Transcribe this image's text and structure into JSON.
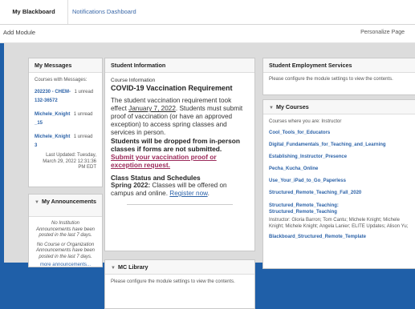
{
  "tabs": {
    "active": "My Blackboard",
    "inactive": "Notifications Dashboard"
  },
  "toolbar": {
    "add_module": "Add Module",
    "personalize": "Personalize Page"
  },
  "messages": {
    "title": "My Messages",
    "intro": "Courses with Messages:",
    "items": [
      {
        "name": "202230 - CHEM-",
        "count": "1 unread",
        "name2": "132-36572"
      },
      {
        "name": "Michele_Knight",
        "count": "1 unread",
        "name2": "_15"
      },
      {
        "name": "Michele_Knight",
        "count": "1 unread",
        "name2": "3"
      }
    ],
    "last_updated": "Last Updated: Tuesday, March 29, 2022 12:31:36 PM EDT"
  },
  "announcements": {
    "title": "My Announcements",
    "no_institution": "No Institution Announcements have been posted in the last 7 days.",
    "no_course": "No Course or Organization Announcements have been posted in the last 7 days.",
    "more": "more announcements..."
  },
  "student_info": {
    "title": "Student Information",
    "section": "Course Information",
    "heading": "COVID-19 Vaccination Requirement",
    "para1_pre": "The student vaccination requirement took effect ",
    "para1_date": "January 7, 2022",
    "para1_post": ". Students must submit proof of vaccination (or have an approved exception) to access spring classes and services in person.",
    "bold_line": "Students will be dropped from in-person classes if forms are not submitted.",
    "submit_link": "Submit your vaccination proof or exception request.",
    "class_status": "Class Status and Schedules",
    "spring_bold": "Spring 2022:",
    "spring_text": " Classes will be offered on campus and online. ",
    "register": "Register now"
  },
  "mc_library": {
    "title": "MC Library",
    "text": "Please configure the module settings to view the contents."
  },
  "employment": {
    "title": "Student Employment Services",
    "text": "Please configure the module settings to view the contents."
  },
  "courses": {
    "title": "My Courses",
    "intro": "Courses where you are: Instructor",
    "items": [
      "Cool_Tools_for_Educators",
      "Digital_Fundamentals_for_Teaching_and_Learning",
      "Establishing_Instructor_Presence",
      "Pecha_Kucha_Online",
      "Use_Your_iPad_to_Go_Paperless",
      "Structured_Remote_Teaching_Fall_2020",
      "Structured_Remote_Teaching: Structured_Remote_Teaching"
    ],
    "instructors": "Instructor: Gloria Barron; Tom Cantu; Michele Knight; Michele Knight; Michele Knight; Angela Lanier; ELITE Updates; Alison Yu;",
    "last_item": "Blackboard_Structured_Remote_Template"
  }
}
